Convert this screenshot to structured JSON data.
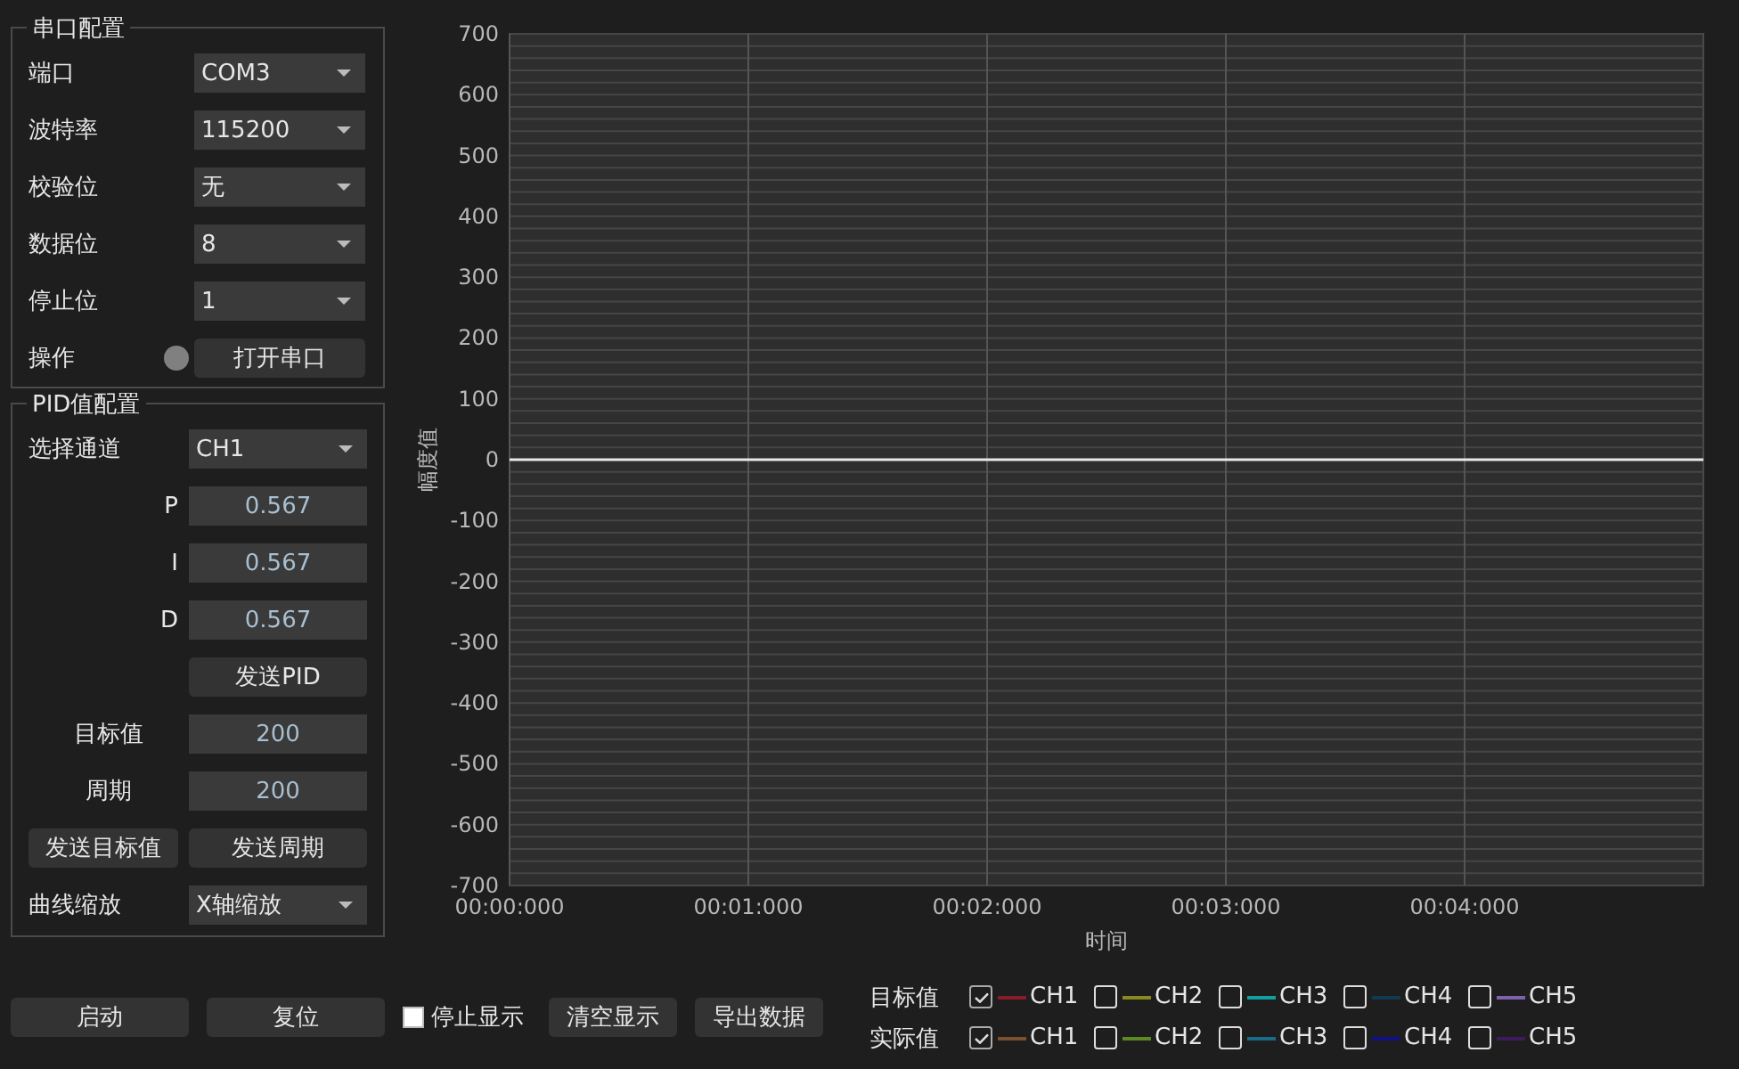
{
  "serial_config": {
    "title": "串口配置",
    "fields": [
      {
        "label": "端口",
        "value": "COM3"
      },
      {
        "label": "波特率",
        "value": "115200"
      },
      {
        "label": "校验位",
        "value": "无"
      },
      {
        "label": "数据位",
        "value": "8"
      },
      {
        "label": "停止位",
        "value": "1"
      }
    ],
    "operation": {
      "label": "操作",
      "connected": false,
      "button": "打开串口"
    }
  },
  "pid_config": {
    "title": "PID值配置",
    "channel": {
      "label": "选择通道",
      "value": "CH1"
    },
    "gains": [
      {
        "label": "P",
        "value": "0.567"
      },
      {
        "label": "I",
        "value": "0.567"
      },
      {
        "label": "D",
        "value": "0.567"
      }
    ],
    "send_pid_button": "发送PID",
    "target": {
      "label": "目标值",
      "value": "200"
    },
    "period": {
      "label": "周期",
      "value": "200"
    },
    "send_target_button": "发送目标值",
    "send_period_button": "发送周期",
    "zoom": {
      "label": "曲线缩放",
      "value": "X轴缩放"
    }
  },
  "chart": {
    "chart_data": {
      "type": "line",
      "xlabel": "时间",
      "ylabel": "幅度值",
      "categories": [
        "00:00:000",
        "00:01:000",
        "00:02:000",
        "00:03:000",
        "00:04:000",
        null
      ],
      "ylim": [
        -700,
        700
      ],
      "grid": true,
      "yticks": [
        700,
        600,
        500,
        400,
        300,
        200,
        100,
        0,
        -100,
        -200,
        -300,
        -400,
        -500,
        -600,
        -700
      ],
      "series": [
        {
          "color": "#e8e8e8",
          "values": [
            0,
            0,
            0,
            0,
            0,
            0
          ]
        }
      ]
    }
  },
  "controls": [
    {
      "kind": "button",
      "label": "启动"
    },
    {
      "kind": "button",
      "label": "复位"
    },
    {
      "kind": "checkbox",
      "label": "停止显示",
      "checked": false
    },
    {
      "kind": "button",
      "label": "清空显示"
    },
    {
      "kind": "button",
      "label": "导出数据"
    }
  ],
  "legend": {
    "rows": [
      {
        "label": "目标值",
        "channels": [
          {
            "label": "CH1",
            "checked": true,
            "color": "#8b1a2a"
          },
          {
            "label": "CH2",
            "checked": false,
            "color": "#8a8a20"
          },
          {
            "label": "CH3",
            "checked": false,
            "color": "#10a0a0"
          },
          {
            "label": "CH4",
            "checked": false,
            "color": "#103a50"
          },
          {
            "label": "CH5",
            "checked": false,
            "color": "#8060b0"
          }
        ]
      },
      {
        "label": "实际值",
        "channels": [
          {
            "label": "CH1",
            "checked": true,
            "color": "#7a5030"
          },
          {
            "label": "CH2",
            "checked": false,
            "color": "#5a8a20"
          },
          {
            "label": "CH3",
            "checked": false,
            "color": "#1a6a8a"
          },
          {
            "label": "CH4",
            "checked": false,
            "color": "#10108a"
          },
          {
            "label": "CH5",
            "checked": false,
            "color": "#401a60"
          }
        ]
      }
    ]
  }
}
